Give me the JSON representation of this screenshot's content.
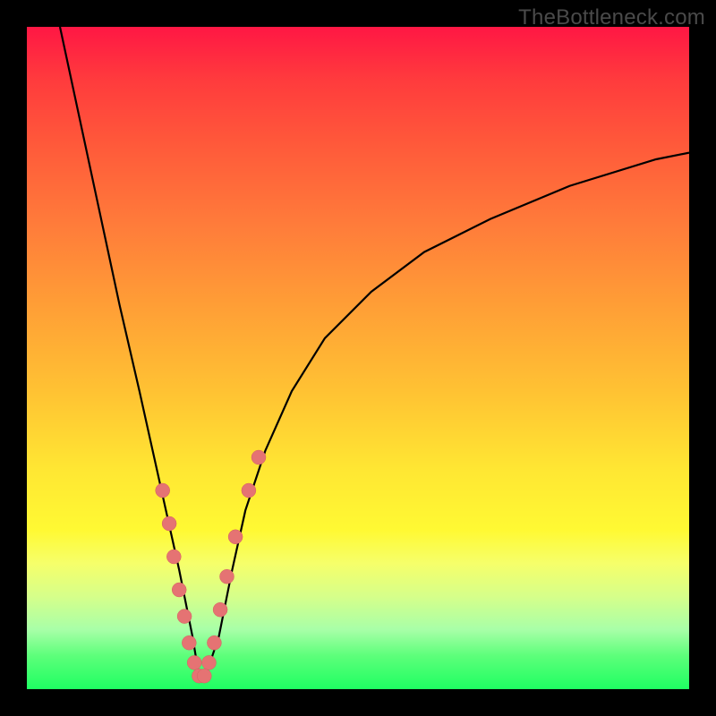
{
  "watermark": {
    "text": "TheBottleneck.com"
  },
  "colors": {
    "background": "#000000",
    "gradient_top": "#ff1744",
    "gradient_bottom": "#1fff62",
    "curve": "#000000",
    "dots": "#e57373"
  },
  "chart_data": {
    "type": "line",
    "title": "",
    "xlabel": "",
    "ylabel": "",
    "xlim": [
      0,
      100
    ],
    "ylim": [
      0,
      100
    ],
    "note": "No numeric axes shown; x and y are normalized 0–100. y=0 is the green bottom, y=100 is the red top. Curve is a V-shape with minimum near x≈26.",
    "series": [
      {
        "name": "bottleneck-curve",
        "x": [
          5,
          8,
          11,
          14,
          17,
          19,
          21,
          23,
          25,
          26,
          27,
          29,
          31,
          33,
          36,
          40,
          45,
          52,
          60,
          70,
          82,
          95,
          100
        ],
        "y": [
          100,
          86,
          72,
          58,
          45,
          36,
          27,
          18,
          8,
          2,
          2,
          8,
          18,
          27,
          36,
          45,
          53,
          60,
          66,
          71,
          76,
          80,
          81
        ]
      }
    ],
    "dots": {
      "name": "highlighted-points",
      "note": "Salmon dots clustered near the V-minimum along both branches",
      "points": [
        {
          "x": 20.5,
          "y": 30
        },
        {
          "x": 21.5,
          "y": 25
        },
        {
          "x": 22.2,
          "y": 20
        },
        {
          "x": 23.0,
          "y": 15
        },
        {
          "x": 23.8,
          "y": 11
        },
        {
          "x": 24.5,
          "y": 7
        },
        {
          "x": 25.3,
          "y": 4
        },
        {
          "x": 26.0,
          "y": 2
        },
        {
          "x": 26.8,
          "y": 2
        },
        {
          "x": 27.5,
          "y": 4
        },
        {
          "x": 28.3,
          "y": 7
        },
        {
          "x": 29.2,
          "y": 12
        },
        {
          "x": 30.2,
          "y": 17
        },
        {
          "x": 31.5,
          "y": 23
        },
        {
          "x": 33.5,
          "y": 30
        },
        {
          "x": 35.0,
          "y": 35
        }
      ]
    }
  }
}
